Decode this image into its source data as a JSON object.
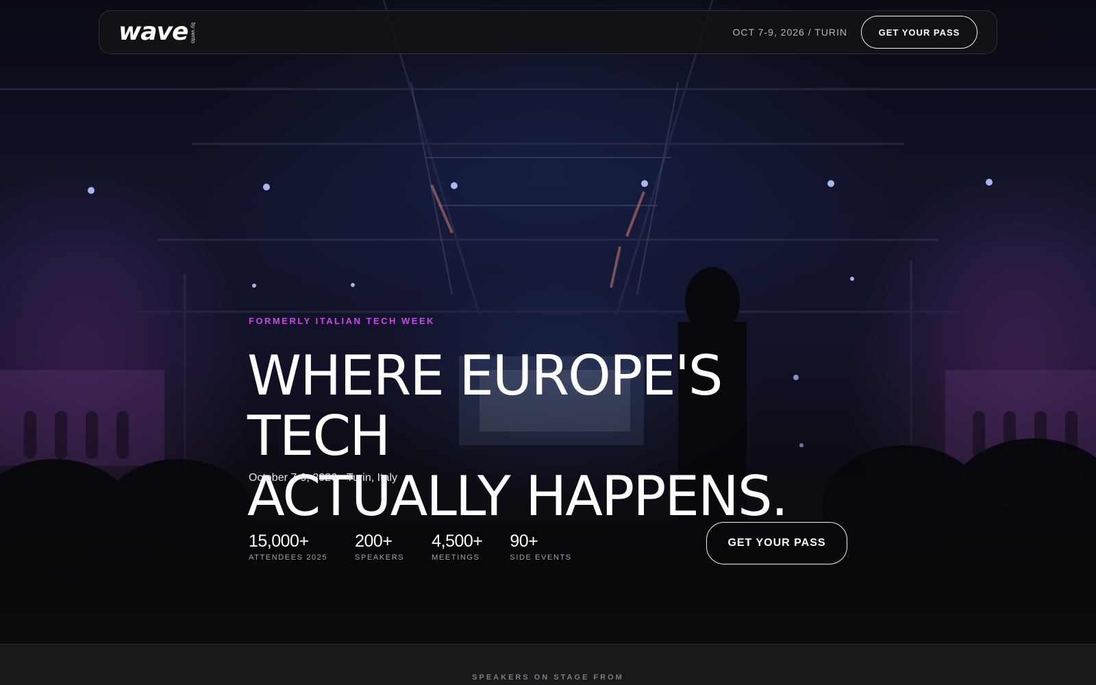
{
  "nav": {
    "logo_text": "wave",
    "logo_sub": "by vento",
    "date_location": "OCT 7-9, 2026 / TURIN",
    "cta_label": "GET YOUR PASS"
  },
  "hero": {
    "eyebrow": "FORMERLY ITALIAN TECH WEEK",
    "headline_line1": "WHERE EUROPE'S TECH",
    "headline_line2": "ACTUALLY HAPPENS.",
    "event_meta": "October 7-9, 2026 · Turin, Italy",
    "stats": [
      {
        "value": "15,000+",
        "label": "ATTENDEES 2025"
      },
      {
        "value": "200+",
        "label": "SPEAKERS"
      },
      {
        "value": "4,500+",
        "label": "MEETINGS"
      },
      {
        "value": "90+",
        "label": "SIDE EVENTS"
      }
    ],
    "cta_label": "GET YOUR PASS"
  },
  "speakers_strip": {
    "label": "SPEAKERS ON STAGE FROM"
  },
  "colors": {
    "accent": "#c64ce0",
    "background": "#0b0b0e",
    "strip": "#19191c"
  }
}
